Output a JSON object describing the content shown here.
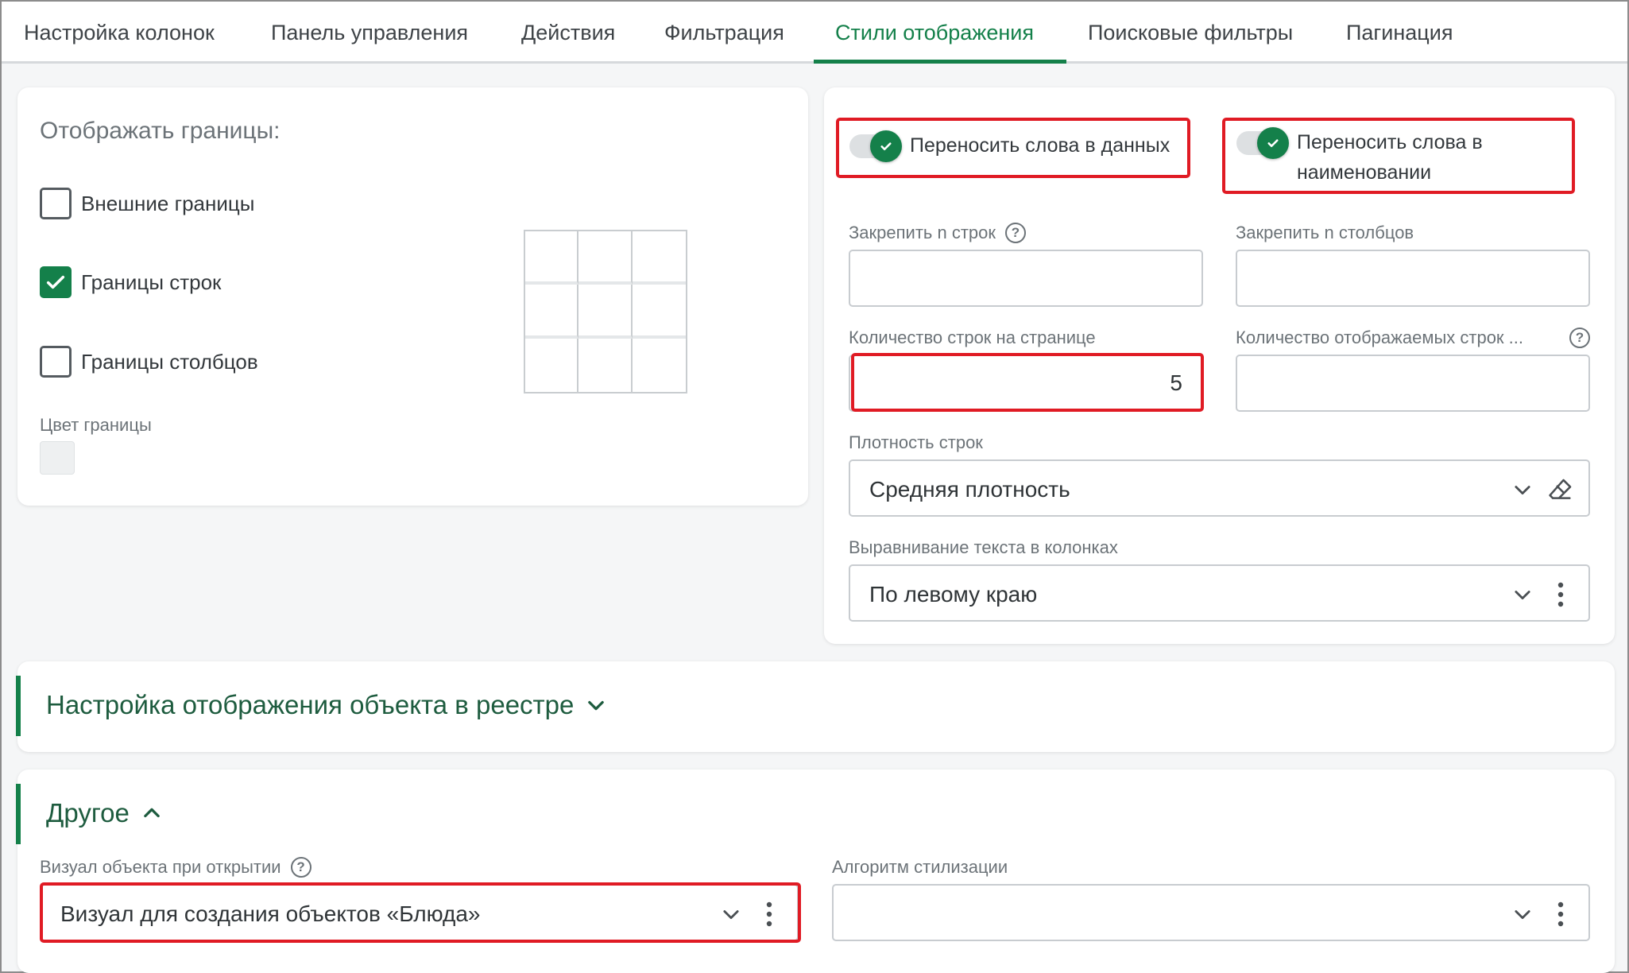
{
  "tabs": [
    {
      "label": "Настройка колонок"
    },
    {
      "label": "Панель управления"
    },
    {
      "label": "Действия"
    },
    {
      "label": "Фильтрация"
    },
    {
      "label": "Стили отображения"
    },
    {
      "label": "Поисковые фильтры"
    },
    {
      "label": "Пагинация"
    }
  ],
  "active_tab": "Стили отображения",
  "borders": {
    "title": "Отображать границы:",
    "outer": {
      "label": "Внешние границы",
      "checked": false
    },
    "rows": {
      "label": "Границы строк",
      "checked": true
    },
    "columns": {
      "label": "Границы столбцов",
      "checked": false
    },
    "color_label": "Цвет границы",
    "color_value": "#eef0f1"
  },
  "wrap": {
    "data": {
      "label": "Переносить слова в данных",
      "on": true
    },
    "name": {
      "label": "Переносить слова в наименовании",
      "on": true
    }
  },
  "fields": {
    "freeze_rows": {
      "label": "Закрепить n строк",
      "value": ""
    },
    "freeze_cols": {
      "label": "Закрепить n столбцов",
      "value": ""
    },
    "rows_per_page": {
      "label": "Количество строк на странице",
      "value": "5"
    },
    "visible_rows": {
      "label": "Количество отображаемых строк ...",
      "value": ""
    },
    "density": {
      "label": "Плотность строк",
      "value": "Средняя плотность"
    },
    "align": {
      "label": "Выравнивание текста в колонках",
      "value": "По левому краю"
    }
  },
  "registry_section": {
    "title": "Настройка отображения объекта в реестре"
  },
  "other_section": {
    "title": "Другое",
    "visual": {
      "label": "Визуал объекта при открытии",
      "value": "Визуал для создания объектов «Блюда»"
    },
    "algorithm": {
      "label": "Алгоритм стилизации",
      "value": ""
    }
  },
  "help_symbol": "?",
  "colors": {
    "accent": "#14804a",
    "highlight": "#e01b24"
  }
}
